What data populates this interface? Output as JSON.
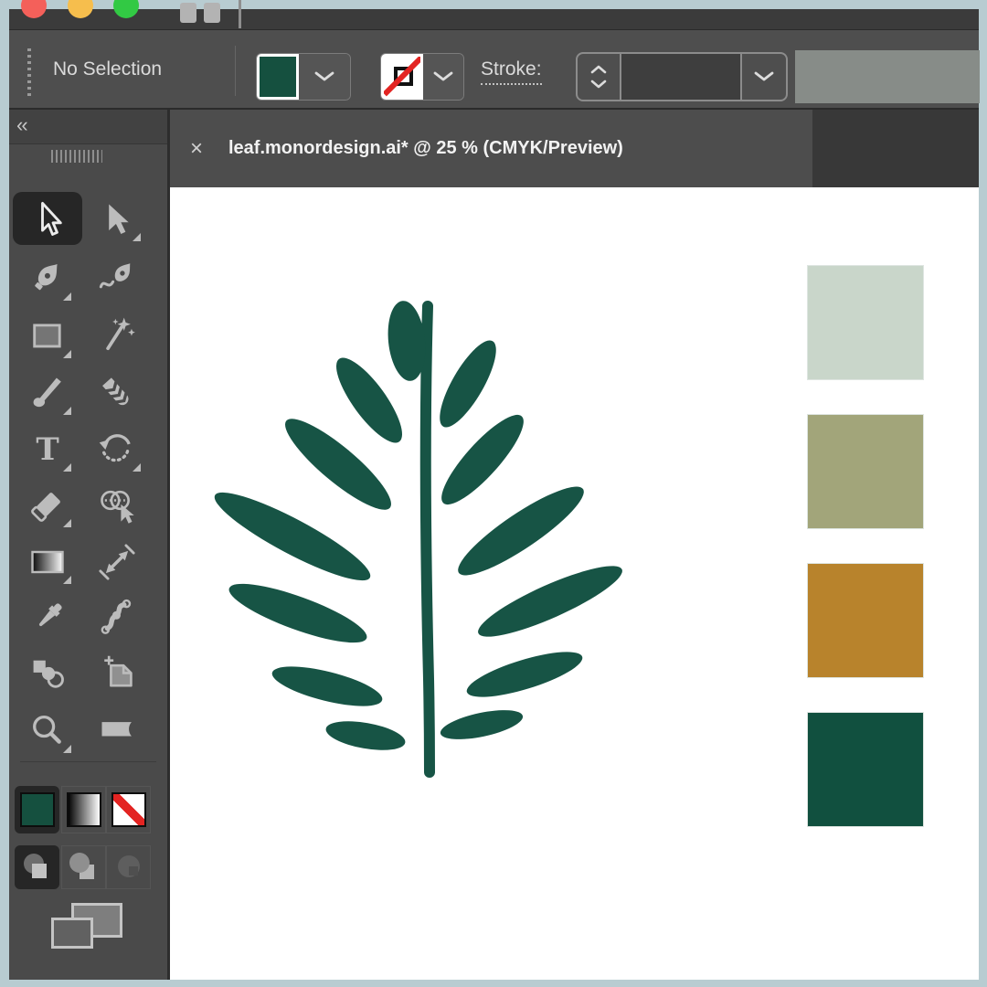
{
  "app": {
    "traffic_lights": [
      "#f4605a",
      "#f6be4d",
      "#32c944"
    ]
  },
  "control_bar": {
    "selection_status": "No Selection",
    "fill_color": "#15503f",
    "stroke_swatch": "none",
    "stroke_label": "Stroke:",
    "stroke_value": "",
    "slash_color": "#e32422"
  },
  "document_tab": {
    "close_label": "×",
    "title": "leaf.monordesign.ai* @ 25 % (CMYK/Preview)"
  },
  "tools_panel": {
    "collapse_label": "‹‹",
    "selected_tool": "selection",
    "tools": [
      "selection",
      "direct-selection",
      "pen",
      "curvature",
      "rectangle",
      "magic-wand",
      "paintbrush",
      "blob-brush",
      "type",
      "rotate",
      "eraser",
      "shape-builder",
      "gradient",
      "scale",
      "eyedropper",
      "puppet-warp",
      "blend",
      "artboard",
      "zoom",
      "knife"
    ],
    "type_glyph": "T",
    "fill_proxy_color": "#15503f",
    "draw_modes": [
      "draw-normal",
      "draw-behind",
      "draw-inside"
    ]
  },
  "canvas": {
    "leaf": {
      "name": "fern-leaf-illustration",
      "color": "#175445"
    },
    "palette": [
      {
        "name": "mint",
        "hex": "#c9d6ca"
      },
      {
        "name": "sage",
        "hex": "#a2a57a"
      },
      {
        "name": "ochre",
        "hex": "#b8832c"
      },
      {
        "name": "forest",
        "hex": "#11503f"
      }
    ]
  }
}
